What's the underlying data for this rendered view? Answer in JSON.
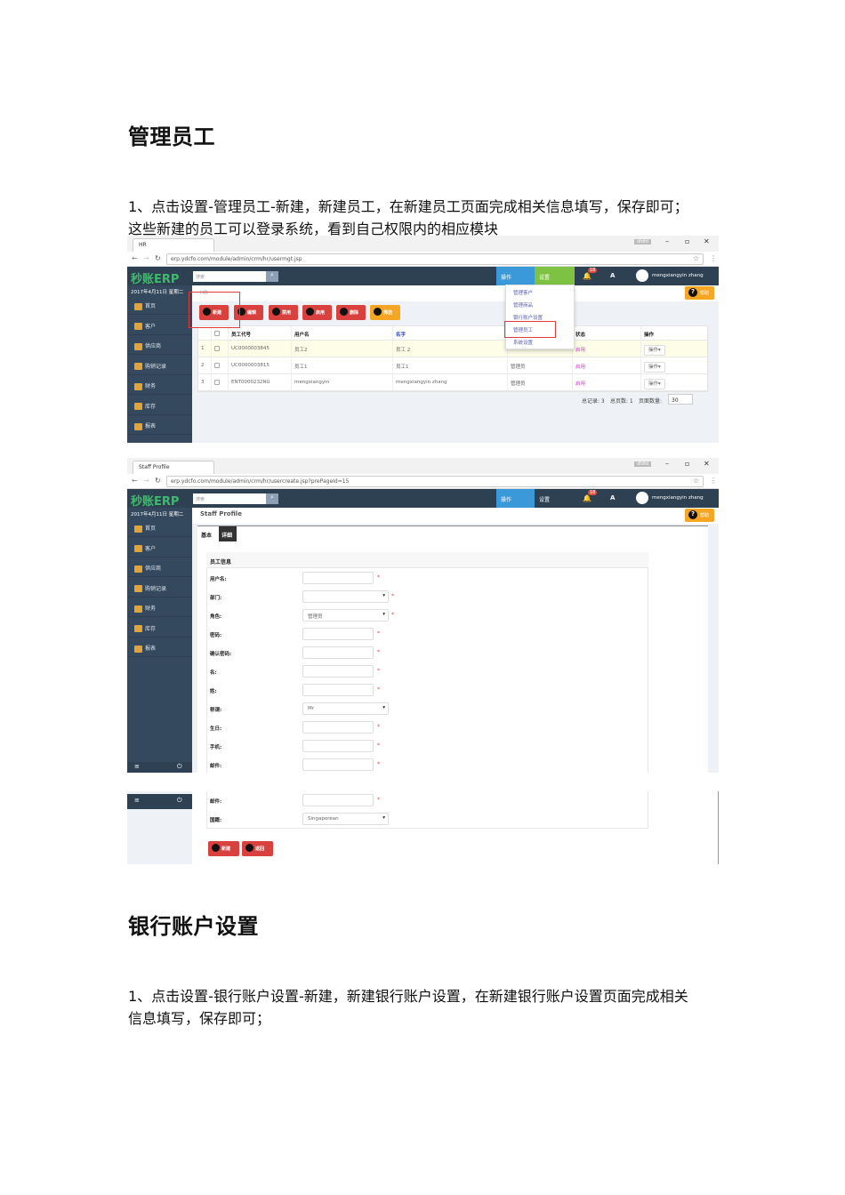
{
  "doc": {
    "heading1": "管理员工",
    "para1": [
      "1、点击设置-管理员工-新建，新建员工，在新建员工页面完成相关信息填写，保存即可；",
      "这些新建的员工可以登录系统，看到自己权限内的相应模块"
    ],
    "heading2": "银行账户设置",
    "para2": [
      "1、点击设置-银行账户设置-新建，新建银行账户设置，在新建银行账户设置页面完成相关",
      "信息填写，保存即可；"
    ]
  },
  "app": {
    "logo": "秒账ERP",
    "search_placeholder": "搜索",
    "nav_ops": "操作",
    "nav_settings": "设置",
    "badge": "18",
    "font_btn": "A",
    "user": "mengxiangyin zhang",
    "date": "2017年4月11日 星期二",
    "help": "帮助",
    "sidebar": [
      "首页",
      "客户",
      "供应商",
      "购销记录",
      "财务",
      "库存",
      "报表"
    ],
    "window_user": "dfdfd"
  },
  "shot1": {
    "tab_title": "HR",
    "url": "erp.ydcfo.com/module/admin/crm/hr/usermgt.jsp",
    "breadcrumb": "HR",
    "toolbar": [
      "新建",
      "编辑",
      "禁用",
      "启用",
      "删除",
      "筛选"
    ],
    "headers": [
      "",
      "",
      "员工代号",
      "用户名",
      "名字",
      "",
      "状态",
      "操作"
    ],
    "rows": [
      [
        "1",
        "",
        "UC0000003845",
        "员工2",
        "员工 2",
        "",
        "启用",
        "操作"
      ],
      [
        "2",
        "",
        "UC0000003815",
        "员工1",
        "员工1",
        "管理员",
        "启用",
        "操作"
      ],
      [
        "3",
        "",
        "ENT0000232NU",
        "mengxiangyin",
        "mengxiangyin zhang",
        "管理员",
        "启用",
        "操作"
      ]
    ],
    "dropdown": [
      "管理客户",
      "管理商品",
      "银行账户设置",
      "管理员工",
      "系统设置"
    ],
    "footer": {
      "total_label": "总记录: 3",
      "pages_label": "总页数: 1",
      "page_size_label": "页面数量:",
      "page_size": "30"
    }
  },
  "shot2": {
    "tab_title": "Staff Profile",
    "url": "erp.ydcfo.com/module/admin/crm/hr/usercreate.jsp?prePageId=15",
    "title": "Staff Profile",
    "tabs": [
      "基本",
      "详细"
    ],
    "panel_title": "员工信息",
    "fields": [
      {
        "label": "用户名:",
        "value": "",
        "type": "input",
        "required": true
      },
      {
        "label": "部门:",
        "value": "",
        "type": "select",
        "required": true
      },
      {
        "label": "角色:",
        "value": "管理员",
        "type": "select",
        "required": true
      },
      {
        "label": "密码:",
        "value": "",
        "type": "input",
        "required": true
      },
      {
        "label": "确认密码:",
        "value": "",
        "type": "input",
        "required": true
      },
      {
        "label": "名:",
        "value": "",
        "type": "input",
        "required": true
      },
      {
        "label": "姓:",
        "value": "",
        "type": "input",
        "required": true
      },
      {
        "label": "称谓:",
        "value": "Mr",
        "type": "select",
        "required": false
      },
      {
        "label": "生日:",
        "value": "",
        "type": "input",
        "required": true
      },
      {
        "label": "手机:",
        "value": "",
        "type": "input",
        "required": true
      },
      {
        "label": "邮件:",
        "value": "",
        "type": "input",
        "required": true
      }
    ]
  },
  "shot3": {
    "fields": [
      {
        "label": "邮件:",
        "value": "",
        "type": "input",
        "required": true
      },
      {
        "label": "国籍:",
        "value": "Singaporean",
        "type": "select",
        "required": false
      }
    ],
    "buttons": [
      "新建",
      "返回"
    ]
  },
  "colors": {
    "header": "#2e4153",
    "sidebar": "#34495e",
    "danger": "#d9413f",
    "warning": "#f5a623",
    "ops": "#3a9ad9",
    "settings": "#7dc243",
    "logo": "#3dbb6a"
  }
}
